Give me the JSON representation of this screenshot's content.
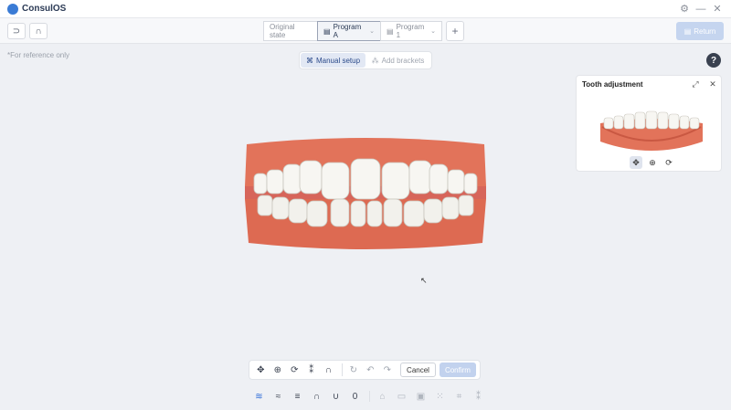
{
  "app": {
    "title": "ConsulOS"
  },
  "window_controls": {
    "settings": "⚙",
    "minimize": "—",
    "close": "✕"
  },
  "toolbar": {
    "left_buttons": [
      "⊃",
      "∩"
    ],
    "tabs": [
      {
        "label": "Original state",
        "icon": "",
        "chevron": "",
        "active": false
      },
      {
        "label": "Program A",
        "icon": "▤",
        "chevron": "⌄",
        "active": true
      },
      {
        "label": "Program 1",
        "icon": "▤",
        "chevron": "⌄",
        "active": false
      }
    ],
    "add_tab": "+",
    "return_icon": "▤",
    "return_label": "Return"
  },
  "note": "*For reference only",
  "modes": [
    {
      "label": "Manual setup",
      "icon": "⌘",
      "active": true
    },
    {
      "label": "Add brackets",
      "icon": "⁂",
      "active": false
    }
  ],
  "help": "?",
  "panel": {
    "title": "Tooth adjustment",
    "expand_icon": "⤢",
    "close_icon": "✕",
    "tools": [
      "✥",
      "⊕",
      "⟳"
    ]
  },
  "action_bar": {
    "tools": [
      "✥",
      "⊕",
      "⟳",
      "⁑",
      "∩"
    ],
    "history": [
      "↻",
      "↶",
      "↷"
    ],
    "cancel": "Cancel",
    "confirm": "Confirm"
  },
  "bottom_bar": {
    "group1": [
      "≋",
      "≈",
      "≡",
      "∩",
      "∪",
      "0"
    ],
    "group2": [
      "⌂",
      "▭",
      "▣",
      "⁙",
      "⌗",
      "⁑"
    ]
  },
  "cursor": "↖",
  "colors": {
    "accent": "#2d6bd8",
    "gum": "#e2735a",
    "tooth": "#f7f6f2"
  }
}
